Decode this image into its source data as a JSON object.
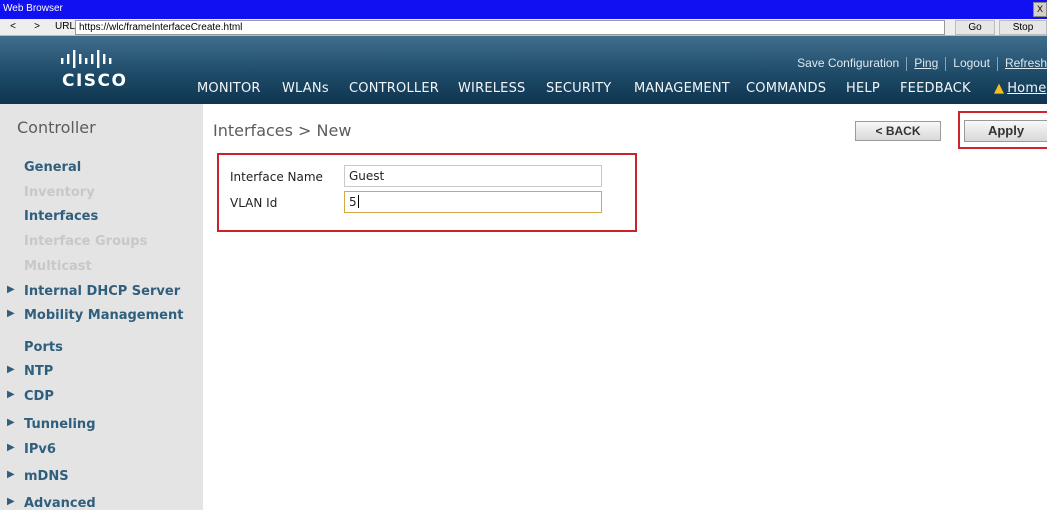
{
  "browser": {
    "title": "Web Browser",
    "close_glyph": "X",
    "back": "<",
    "forward": ">",
    "url_label": "URL",
    "url": "https://wlc/frameInterfaceCreate.html",
    "go": "Go",
    "stop": "Stop"
  },
  "brand": {
    "logo_text": "CISCO"
  },
  "top_links": {
    "save_configuration": "Save Configuration",
    "ping": "Ping",
    "logout": "Logout",
    "refresh": "Refresh"
  },
  "nav": {
    "monitor": "MONITOR",
    "wlans": "WLANs",
    "controller": "CONTROLLER",
    "wireless": "WIRELESS",
    "security": "SECURITY",
    "management": "MANAGEMENT",
    "commands": "COMMANDS",
    "help": "HELP",
    "feedback": "FEEDBACK",
    "home": "Home"
  },
  "sidebar": {
    "title": "Controller",
    "items": [
      {
        "label": "General"
      },
      {
        "label": "Inventory"
      },
      {
        "label": "Interfaces"
      },
      {
        "label": "Interface Groups"
      },
      {
        "label": "Multicast"
      },
      {
        "label": "Internal DHCP Server"
      },
      {
        "label": "Mobility Management"
      },
      {
        "label": "Ports"
      },
      {
        "label": "NTP"
      },
      {
        "label": "CDP"
      },
      {
        "label": "Tunneling"
      },
      {
        "label": "IPv6"
      },
      {
        "label": "mDNS"
      },
      {
        "label": "Advanced"
      }
    ]
  },
  "main": {
    "title": "Interfaces > New",
    "back_button": "< BACK",
    "apply_button": "Apply",
    "form": {
      "interface_name_label": "Interface Name",
      "interface_name_value": "Guest",
      "vlan_id_label": "VLAN Id",
      "vlan_id_value": "5"
    }
  },
  "colors": {
    "header_dark": "#0f3550",
    "sidebar_link": "#2f5f7c",
    "highlight_red": "#c8232c",
    "browser_titlebar": "#1010f0"
  }
}
